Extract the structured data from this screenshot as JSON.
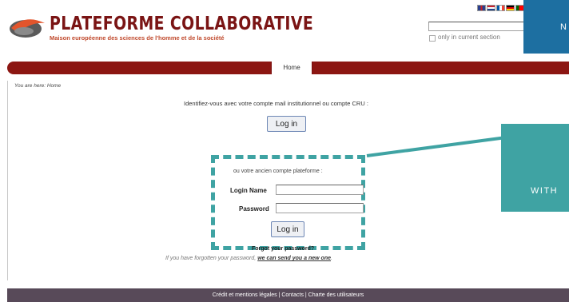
{
  "header": {
    "logo_title": "PLATEFORME COLLABORATIVE",
    "logo_subtitle": "Maison européenne des sciences de l'homme et de la société",
    "flags": [
      {
        "name": "uk-flag",
        "colors": [
          "#2a3f8f",
          "#cc2020",
          "#ffffff"
        ]
      },
      {
        "name": "netherlands-flag",
        "colors": [
          "#c8222e",
          "#ffffff",
          "#21468b"
        ]
      },
      {
        "name": "france-flag",
        "colors": [
          "#0055a4",
          "#ffffff",
          "#ef4135"
        ]
      },
      {
        "name": "germany-flag",
        "colors": [
          "#000000",
          "#dd0000",
          "#ffce00"
        ]
      },
      {
        "name": "portugal-flag",
        "colors": [
          "#006600",
          "#ff0000",
          "#ff0000"
        ]
      }
    ]
  },
  "search": {
    "value": "",
    "only_current_section_label": "only in current section"
  },
  "overlay": {
    "top_right_text": "N",
    "side_text": "WITH",
    "colors": {
      "teal": "#3fa3a3",
      "blue": "#1d6fa1"
    }
  },
  "nav": {
    "home_label": "Home",
    "bar_color": "#8c1612"
  },
  "breadcrumb": "You are here: Home",
  "login": {
    "intro": "Identifiez-vous avec votre compte mail institutionnel ou compte CRU :",
    "institutional_button": "Log in",
    "alt_account_text": "ou votre ancien compte plateforme :",
    "login_name_label": "Login Name",
    "password_label": "Password",
    "login_name_value": "",
    "password_value": "",
    "submit_button": "Log in",
    "forgot_link": "Forgot your password?",
    "forgot_text_prefix": "If you have forgotten your password, ",
    "forgot_text_link": "we can send you a new one",
    "forgot_text_suffix": "."
  },
  "footer": {
    "text": "Crédit et mentions légales | Contacts | Charte des utilisateurs",
    "bg_color": "#584a59"
  }
}
